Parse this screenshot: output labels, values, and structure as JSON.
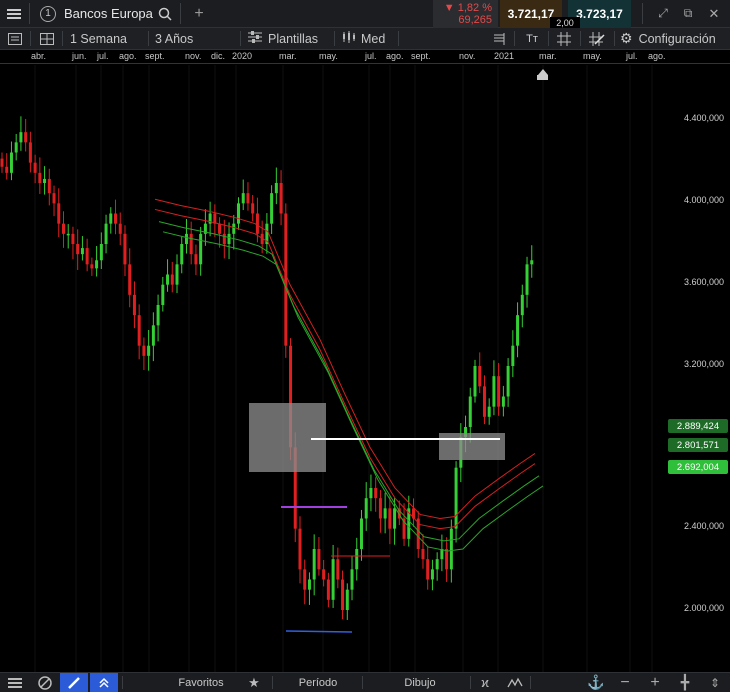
{
  "instrument": {
    "number": "1",
    "name": "Bancos Europa"
  },
  "change": {
    "percent": "1,82 %",
    "points": "69,265",
    "direction": "down"
  },
  "quote": {
    "sell": "3.721,17",
    "buy": "3.723,17",
    "spread": "2,00"
  },
  "toolbar": {
    "interval": "1 Semana",
    "range": "3 Años",
    "templates": "Plantillas",
    "price_type": "Med",
    "settings": "Configuración",
    "text_tool": "Tт"
  },
  "months": [
    "abr.",
    "jun.",
    "jul.",
    "ago.",
    "sept.",
    "nov.",
    "dic.",
    "2020",
    "mar.",
    "may.",
    "jul.",
    "ago.",
    "sept.",
    "nov.",
    "2021",
    "mar.",
    "may.",
    "jul.",
    "ago."
  ],
  "price_axis": [
    "4.400,000",
    "4.000,000",
    "3.600,000",
    "3.200,000",
    "2.400,000",
    "2.000,000"
  ],
  "price_labels": [
    {
      "text": "2.889,424",
      "color": "#1e6b28"
    },
    {
      "text": "2.801,571",
      "color": "#1e6b28"
    },
    {
      "text": "2.692,004",
      "color": "#2fbf3a"
    }
  ],
  "bottom": {
    "favorites": "Favoritos",
    "period": "Período",
    "drawing": "Dibujo"
  },
  "colors": {
    "up": "#35d035",
    "down": "#e02020",
    "red_band": "#d42020",
    "green_band": "#2aa52a"
  },
  "chart_data": {
    "type": "candlestick",
    "ylim": [
      1800,
      4600
    ],
    "weekly_closes": [
      4180,
      4150,
      4250,
      4300,
      4350,
      4300,
      4200,
      4150,
      4100,
      4120,
      4050,
      4000,
      3900,
      3850,
      3850,
      3800,
      3750,
      3780,
      3700,
      3680,
      3720,
      3800,
      3900,
      3950,
      3900,
      3850,
      3700,
      3550,
      3450,
      3300,
      3250,
      3300,
      3400,
      3500,
      3600,
      3650,
      3600,
      3700,
      3800,
      3850,
      3750,
      3700,
      3850,
      3900,
      3950,
      3900,
      3850,
      3800,
      3850,
      3900,
      4000,
      4050,
      4000,
      3950,
      3850,
      3800,
      3900,
      4050,
      4100,
      3950,
      3300,
      2800,
      2400,
      2200,
      2100,
      2150,
      2300,
      2200,
      2150,
      2050,
      2250,
      2150,
      2000,
      2100,
      2200,
      2300,
      2450,
      2550,
      2600,
      2550,
      2450,
      2500,
      2400,
      2500,
      2450,
      2350,
      2500,
      2450,
      2300,
      2250,
      2150,
      2200,
      2250,
      2300,
      2200,
      2400,
      2700,
      2850,
      2900,
      3050,
      3200,
      3100,
      2950,
      3000,
      3150,
      3000,
      3050,
      3200,
      3300,
      3450,
      3550,
      3700,
      3720
    ]
  }
}
